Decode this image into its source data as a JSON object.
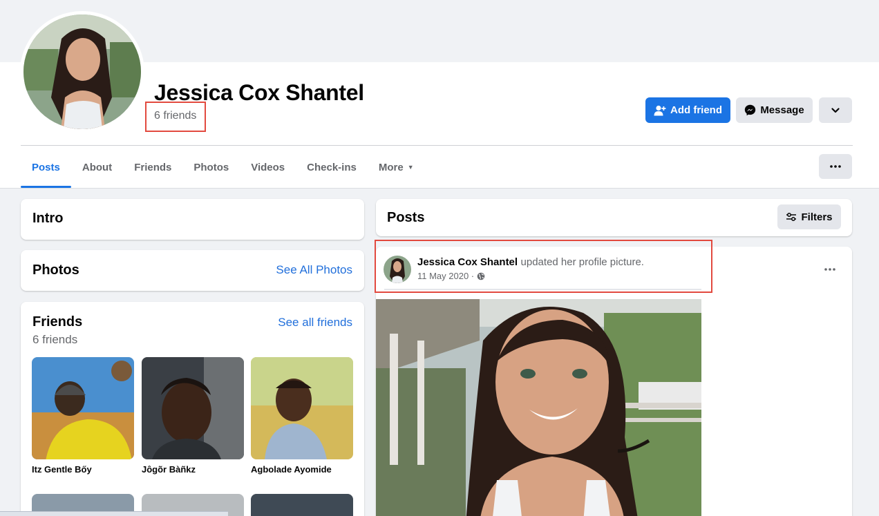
{
  "profile": {
    "name": "Jessica Cox Shantel",
    "friend_count": "6 friends"
  },
  "actions": {
    "add_friend": "Add friend",
    "message": "Message"
  },
  "tabs": [
    {
      "label": "Posts"
    },
    {
      "label": "About"
    },
    {
      "label": "Friends"
    },
    {
      "label": "Photos"
    },
    {
      "label": "Videos"
    },
    {
      "label": "Check-ins"
    },
    {
      "label": "More"
    }
  ],
  "intro": {
    "title": "Intro"
  },
  "photos": {
    "title": "Photos",
    "link": "See All Photos"
  },
  "friends": {
    "title": "Friends",
    "count": "6 friends",
    "link": "See all friends",
    "items": [
      {
        "name": "Itz Gentle Bőy"
      },
      {
        "name": "Jôgõr Bàñkz"
      },
      {
        "name": "Agbolade Ayomide"
      }
    ]
  },
  "posts": {
    "title": "Posts",
    "filters": "Filters",
    "post": {
      "author": "Jessica Cox Shantel",
      "action": "updated her profile picture.",
      "date": "11 May 2020 ·"
    }
  },
  "colors": {
    "accent": "#1b74e4",
    "link": "#216fdb",
    "highlight": "#e2493e",
    "background": "#f0f2f5"
  }
}
